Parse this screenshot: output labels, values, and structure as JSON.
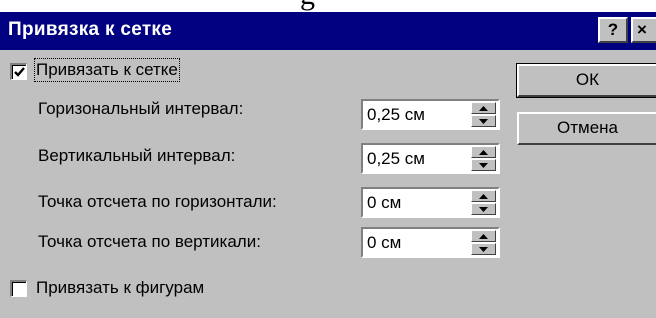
{
  "top_fragment": "g",
  "window": {
    "title": "Привязка к сетке",
    "help_button": "?",
    "close_button": "×"
  },
  "snap_to_grid": {
    "label": "Привязать к сетке",
    "checked": true
  },
  "fields": [
    {
      "label": "Горизональный интервал:",
      "value": "0,25 см"
    },
    {
      "label": "Вертикальный интервал:",
      "value": "0,25 см"
    },
    {
      "label": "Точка отсчета по горизонтали:",
      "value": "0 см"
    },
    {
      "label": "Точка отсчета по вертикали:",
      "value": "0 см"
    }
  ],
  "snap_to_shapes": {
    "label": "Привязать к фигурам",
    "checked": false
  },
  "buttons": {
    "ok": "ОК",
    "cancel": "Отмена"
  },
  "colors": {
    "titlebar": "#000080",
    "dialog_face": "#c0c0c0"
  }
}
